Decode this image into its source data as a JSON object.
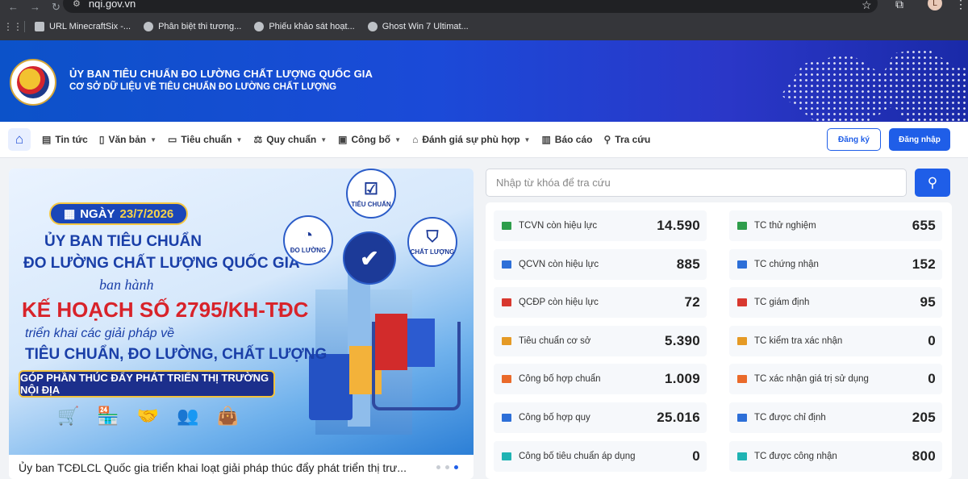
{
  "browser": {
    "url": "nqi.gov.vn",
    "profile_initial": "L",
    "bookmarks": [
      {
        "label": "URL MinecraftSix -..."
      },
      {
        "label": "Phân biệt thi tương..."
      },
      {
        "label": "Phiếu khảo sát hoạt..."
      },
      {
        "label": "Ghost Win 7 Ultimat..."
      }
    ]
  },
  "header": {
    "title": "ỦY BAN TIÊU CHUẨN ĐO LƯỜNG CHẤT LƯỢNG QUỐC GIA",
    "subtitle": "CƠ SỞ DỮ LIỆU VỀ TIÊU CHUẨN ĐO LƯỜNG CHẤT LƯỢNG"
  },
  "menu": {
    "items": [
      {
        "label": "Tin tức",
        "icon": "newspaper-icon",
        "dropdown": false
      },
      {
        "label": "Văn bản",
        "icon": "document-icon",
        "dropdown": true
      },
      {
        "label": "Tiêu chuẩn",
        "icon": "book-icon",
        "dropdown": true
      },
      {
        "label": "Quy chuẩn",
        "icon": "scale-icon",
        "dropdown": true
      },
      {
        "label": "Công bố",
        "icon": "clipboard-icon",
        "dropdown": true
      },
      {
        "label": "Đánh giá sự phù hợp",
        "icon": "bank-icon",
        "dropdown": true
      },
      {
        "label": "Báo cáo",
        "icon": "bar-chart-icon",
        "dropdown": false
      },
      {
        "label": "Tra cứu",
        "icon": "search-icon",
        "dropdown": false
      }
    ],
    "register_label": "Đăng ký",
    "login_label": "Đăng nhập"
  },
  "slider": {
    "date_prefix": "NGÀY",
    "date": "23/7/2026",
    "line1": "ỦY BAN TIÊU CHUẨN",
    "line2": "ĐO LƯỜNG CHẤT LƯỢNG QUỐC GIA",
    "line3": "ban hành",
    "line4": "KẾ HOẠCH SỐ 2795/KH-TĐC",
    "line5": "triển khai các giải pháp về",
    "line6": "TIÊU CHUẨN, ĐO LƯỜNG, CHẤT LƯỢNG",
    "bar": "GÓP PHẦN THÚC ĐẨY PHÁT TRIỂN THỊ TRƯỜNG NỘI ĐỊA",
    "circle_top": "TIÊU CHUẨN",
    "circle_left": "ĐO LƯỜNG",
    "circle_right": "CHẤT LƯỢNG",
    "caption": "Ủy ban TCĐLCL Quốc gia triển khai loạt giải pháp thúc đẩy phát triển thị trư...",
    "dots_total": 3,
    "active_dot": 3
  },
  "search": {
    "placeholder": "Nhập từ khóa để tra cứu"
  },
  "stats": {
    "left": [
      {
        "label": "TCVN còn hiệu lực",
        "value": "14.590",
        "color": "#2e9d4b"
      },
      {
        "label": "QCVN còn hiệu lực",
        "value": "885",
        "color": "#2d6fd8"
      },
      {
        "label": "QCĐP còn hiệu lực",
        "value": "72",
        "color": "#d8382f"
      },
      {
        "label": "Tiêu chuẩn cơ sở",
        "value": "5.390",
        "color": "#e59a25"
      },
      {
        "label": "Công bố hợp chuẩn",
        "value": "1.009",
        "color": "#ea6a2a"
      },
      {
        "label": "Công bố hợp quy",
        "value": "25.016",
        "color": "#2d6fd8"
      },
      {
        "label": "Công bố tiêu chuẩn áp dụng",
        "value": "0",
        "color": "#1fb3b3"
      }
    ],
    "right": [
      {
        "label": "TC thử nghiệm",
        "value": "655",
        "color": "#2e9d4b"
      },
      {
        "label": "TC chứng nhận",
        "value": "152",
        "color": "#2d6fd8"
      },
      {
        "label": "TC giám định",
        "value": "95",
        "color": "#d8382f"
      },
      {
        "label": "TC kiểm tra xác nhận",
        "value": "0",
        "color": "#e59a25"
      },
      {
        "label": "TC xác nhận giá trị sử dụng",
        "value": "0",
        "color": "#ea6a2a"
      },
      {
        "label": "TC được chỉ định",
        "value": "205",
        "color": "#2d6fd8"
      },
      {
        "label": "TC được công nhận",
        "value": "800",
        "color": "#1fb3b3"
      }
    ]
  }
}
